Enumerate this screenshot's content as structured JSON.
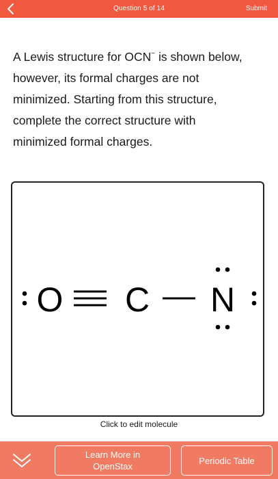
{
  "header": {
    "question_counter": "Question 5 of 14",
    "submit_label": "Submit",
    "bar_color": "#f0593f"
  },
  "question": {
    "line_1": "A Lewis structure for OCN",
    "charge": "−",
    "line_1_end": " is shown below,",
    "line_2": "however, its formal charges are not",
    "line_3": "minimized. Starting from this structure,",
    "line_4": "complete the correct structure with",
    "line_5": "minimized formal charges."
  },
  "molecule": {
    "atoms": [
      "O",
      "C",
      "N"
    ],
    "caption": "Click to edit molecule"
  },
  "footer": {
    "bar_color": "#f07a62",
    "learn_more_line1": "Learn More in",
    "learn_more_line2": "OpenStax",
    "periodic_table_label": "Periodic Table"
  },
  "icons": {
    "back": "chevron-left-icon",
    "collapse": "double-chevron-down-icon"
  }
}
